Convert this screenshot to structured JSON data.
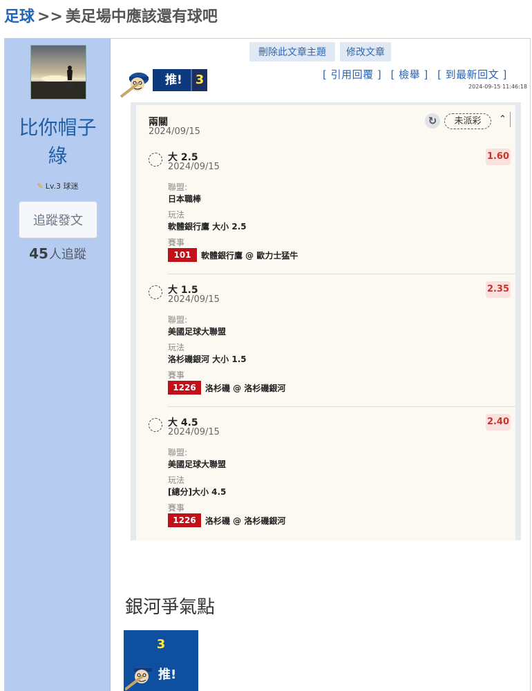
{
  "breadcrumb": {
    "category": "足球",
    "separator": ">>",
    "title": "美足場中應該還有球吧"
  },
  "author": {
    "name_line1": "比你帽子",
    "name_line2": "綠",
    "level": "Lv.3 球迷",
    "follow_label": "追蹤發文",
    "follower_count": "45",
    "follower_suffix": "人追蹤"
  },
  "post": {
    "delete_label": "刪除此文章主題",
    "edit_label": "修改文章",
    "push_label": "推!",
    "push_count": "3",
    "quote_link": "[ 引用回覆 ]",
    "report_link": "[ 檢舉 ]",
    "latest_link": "[ 到最新回文 ]",
    "timestamp": "2024-09-15 11:46:18"
  },
  "slip": {
    "title": "兩關",
    "date": "2024/09/15",
    "status": "未派彩",
    "label_league": "聯盟:",
    "label_play": "玩法",
    "label_event": "賽事",
    "bets": [
      {
        "pick": "大 2.5",
        "date": "2024/09/15",
        "odds": "1.60",
        "league": "日本職棒",
        "play": "軟體銀行鷹 大小 2.5",
        "match_id": "101",
        "match": "軟體銀行鷹 @ 歐力士猛牛"
      },
      {
        "pick": "大 1.5",
        "date": "2024/09/15",
        "odds": "2.35",
        "league": "美國足球大聯盟",
        "play": "洛杉磯銀河 大小 1.5",
        "match_id": "1226",
        "match": "洛杉磯 @ 洛杉磯銀河"
      },
      {
        "pick": "大 4.5",
        "date": "2024/09/15",
        "odds": "2.40",
        "league": "美國足球大聯盟",
        "play": "[總分]大小 4.5",
        "match_id": "1226",
        "match": "洛杉磯 @ 洛杉磯銀河"
      }
    ]
  },
  "comment": {
    "text": "銀河爭氣點",
    "push_count": "3",
    "push_label": "推!"
  },
  "colors": {
    "link": "#2563b8",
    "sidebar": "#b5cbf0",
    "odds": "#c1372d",
    "match_badge": "#c2101a"
  }
}
